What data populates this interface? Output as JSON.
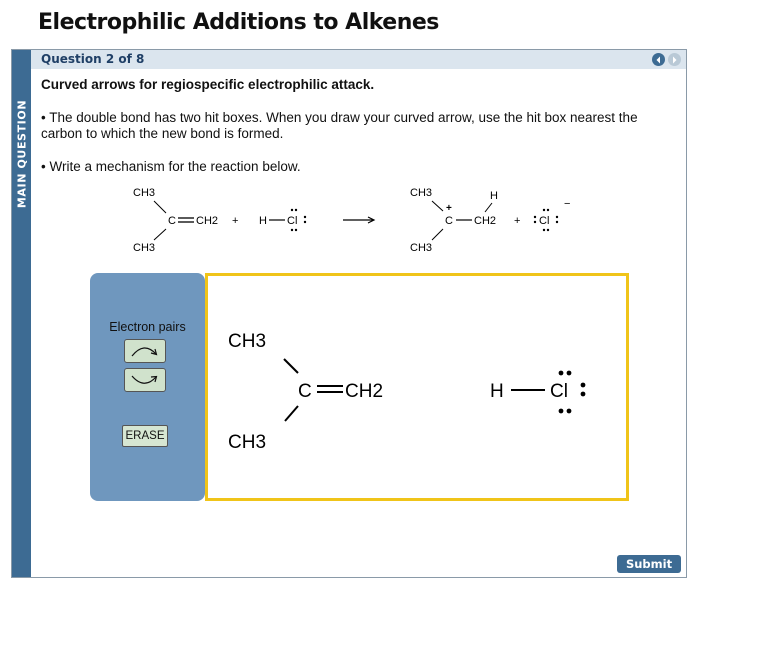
{
  "page": {
    "title": "Electrophilic Additions to Alkenes"
  },
  "side_tab": {
    "label": "MAIN QUESTION"
  },
  "question": {
    "counter": "Question 2 of 8",
    "subtitle": "Curved arrows for regiospecific electrophilic attack.",
    "bullets": [
      "• The double bond has two hit boxes. When you draw your curved arrow, use the hit box nearest the carbon to which the new bond is formed.",
      "• Write a mechanism for the reaction below."
    ]
  },
  "reaction": {
    "reactant_methyl": "CH3",
    "reactant_carbon": "C",
    "reactant_ch2": "CH2",
    "plus": "+",
    "hcl_h": "H",
    "hcl_cl": "Cl",
    "product_carbon": "C",
    "product_charge": "+",
    "product_h": "H",
    "chloride_charge": "−"
  },
  "tools": {
    "title": "Electron pairs",
    "buttons": [
      "curved-arrow-clockwise-icon",
      "curved-arrow-counterclockwise-icon"
    ],
    "erase_label": "ERASE"
  },
  "canvas": {
    "methyl": "CH3",
    "carbon": "C",
    "ch2": "CH2",
    "h": "H",
    "cl": "Cl"
  },
  "nav": {
    "prev_icon": "chevron-left-icon",
    "next_icon": "chevron-right-icon"
  },
  "submit": {
    "label": "Submit"
  },
  "colors": {
    "accent": "#3d6b93",
    "header_bg": "#dbe5ee",
    "tool_panel": "#6f97be",
    "canvas_border": "#f0c419",
    "tool_button": "#d0e2cc"
  }
}
